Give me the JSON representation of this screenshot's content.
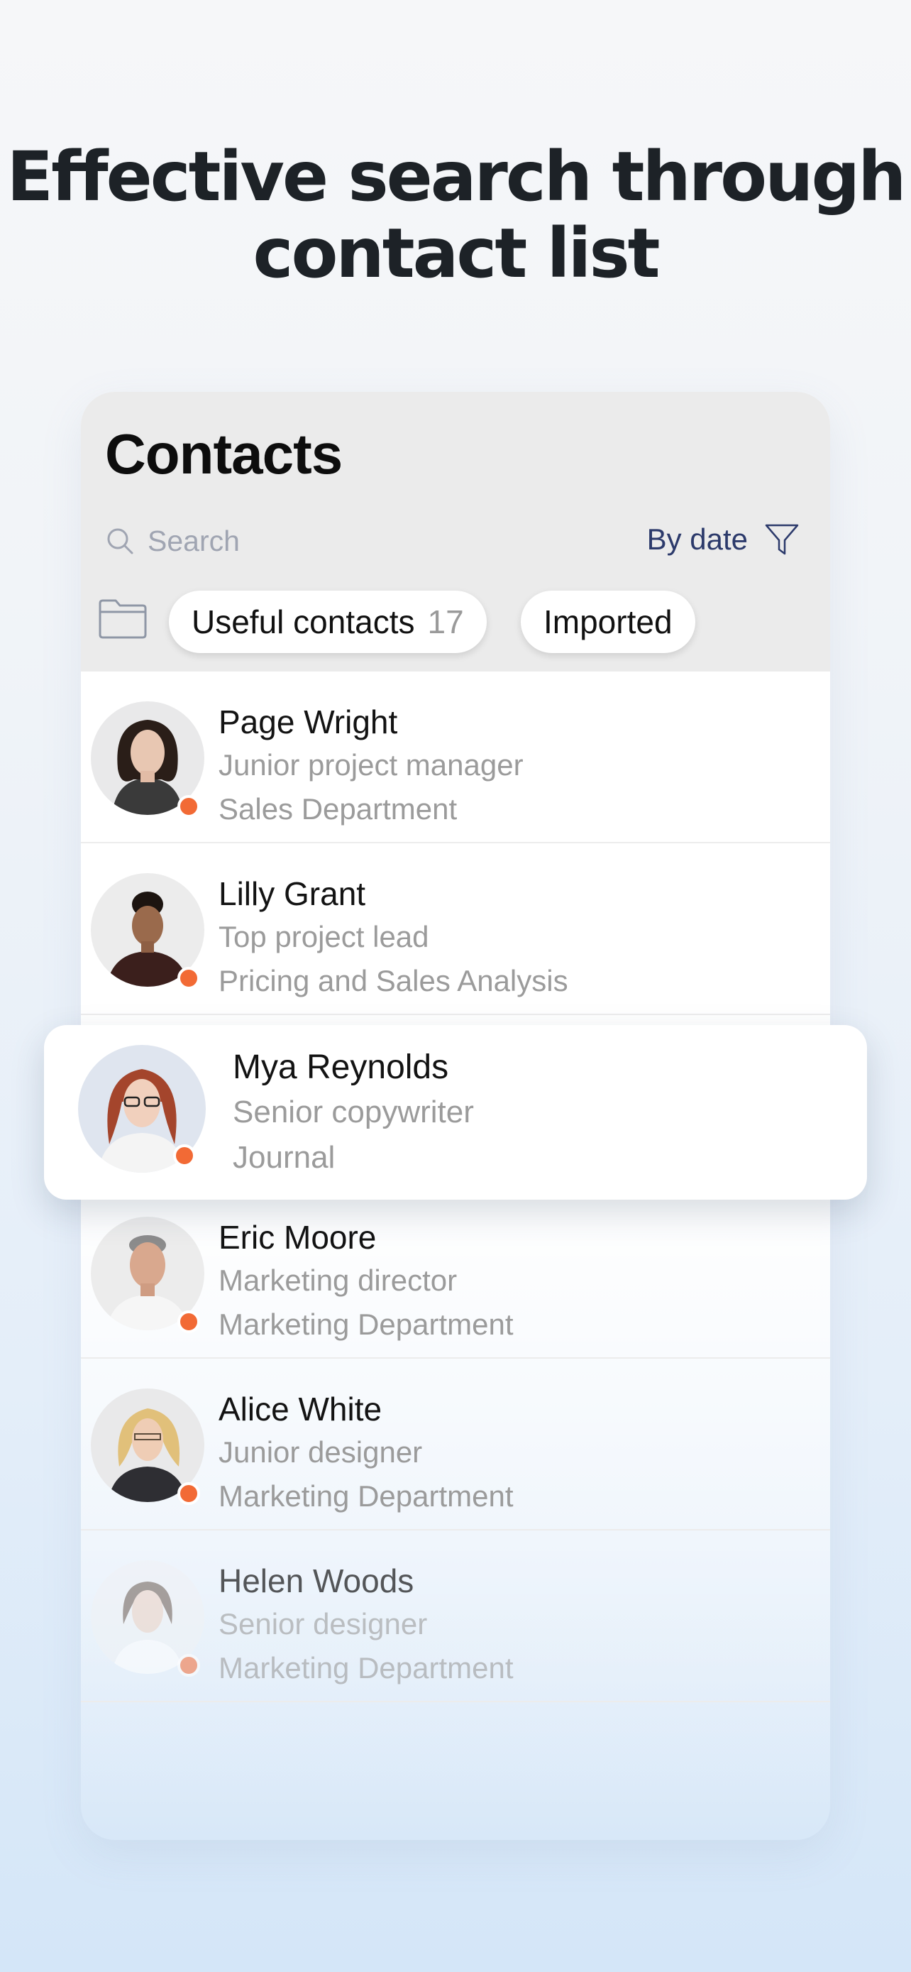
{
  "headline": {
    "line1": "Effective search through",
    "line2": "contact list"
  },
  "contacts": {
    "title": "Contacts",
    "search": {
      "placeholder": "Search",
      "icon": "search-icon"
    },
    "sort": {
      "label": "By date",
      "icon": "filter-icon"
    },
    "folder_icon": "folder-icon",
    "chips": [
      {
        "label": "Useful contacts",
        "count": "17"
      },
      {
        "label": "Imported"
      }
    ],
    "list": [
      {
        "name": "Page Wright",
        "role": "Junior project manager",
        "department": "Sales Department"
      },
      {
        "name": "Lilly Grant",
        "role": "Top project lead",
        "department": "Pricing and Sales Analysis"
      },
      {
        "name": "Mya Reynolds",
        "role": "Senior copywriter",
        "department": "Journal"
      },
      {
        "name": "Eric Moore",
        "role": "Marketing director",
        "department": "Marketing Department"
      },
      {
        "name": "Alice White",
        "role": "Junior designer",
        "department": "Marketing Department"
      },
      {
        "name": "Helen Woods",
        "role": "Senior designer",
        "department": "Marketing Department"
      }
    ],
    "status_color": "#f26a35"
  }
}
